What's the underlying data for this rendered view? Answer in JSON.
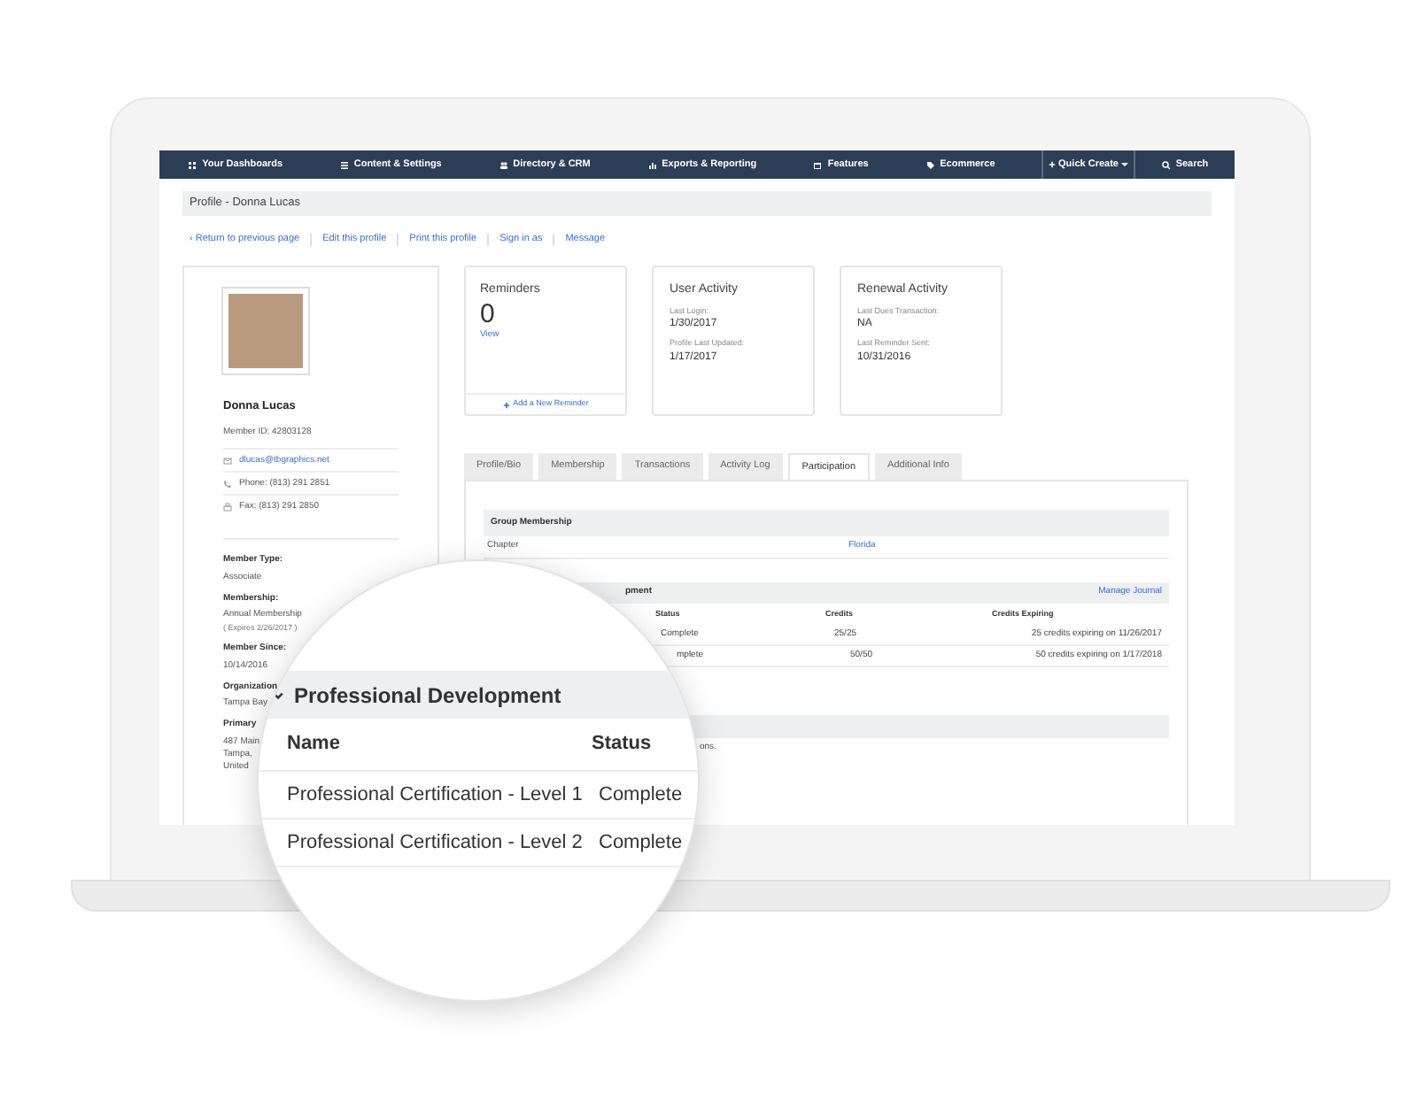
{
  "nav": {
    "items": [
      {
        "label": "Your Dashboards"
      },
      {
        "label": "Content & Settings"
      },
      {
        "label": "Directory & CRM"
      },
      {
        "label": "Exports & Reporting"
      },
      {
        "label": "Features"
      },
      {
        "label": "Ecommerce"
      }
    ],
    "quick_create": "Quick Create",
    "search": "Search"
  },
  "page_title": "Profile - Donna Lucas",
  "actions": [
    "‹ Return to previous page",
    "Edit this profile",
    "Print this profile",
    "Sign in as",
    "Message"
  ],
  "profile": {
    "name": "Donna Lucas",
    "member_id": "Member ID: 42803128",
    "contacts": [
      {
        "kind": "email",
        "text": "dlucas@tbgraphics.net"
      },
      {
        "kind": "phone",
        "text": "Phone: (813) 291 2851"
      },
      {
        "kind": "fax",
        "text": "Fax: (813) 291 2850"
      }
    ],
    "fields": [
      {
        "label": "Member Type:",
        "lines": [
          "Associate"
        ]
      },
      {
        "label": "Membership:",
        "lines": [
          "Annual Membership",
          "( Expires 2/26/2017 )"
        ]
      },
      {
        "label": "Member Since:",
        "lines": [
          "10/14/2016"
        ]
      },
      {
        "label": "Organization",
        "lines": [
          "Tampa Bay"
        ]
      },
      {
        "label": "Primary",
        "lines": [
          "487 Main",
          "Tampa,",
          "United"
        ]
      }
    ]
  },
  "reminders": {
    "title": "Reminders",
    "count": "0",
    "link": "View",
    "footer": "Add a New Reminder"
  },
  "activity_cards": [
    {
      "title": "User Activity",
      "items": [
        {
          "label": "Last Login:",
          "value": "1/30/2017"
        },
        {
          "label": "Profile Last Updated:",
          "value": "1/17/2017"
        }
      ]
    },
    {
      "title": "Renewal Activity",
      "items": [
        {
          "label": "Last Dues Transaction:",
          "value": "NA"
        },
        {
          "label": "Last Reminder Sent:",
          "value": "10/31/2016"
        }
      ]
    }
  ],
  "tabs": [
    {
      "label": "Profile/Bio",
      "selected": false
    },
    {
      "label": "Membership",
      "selected": false
    },
    {
      "label": "Transactions",
      "selected": false
    },
    {
      "label": "Activity Log",
      "selected": false
    },
    {
      "label": "Participation",
      "selected": true
    },
    {
      "label": "Additional Info",
      "selected": false
    }
  ],
  "group_membership": {
    "title": "Group Membership",
    "rows": [
      {
        "label": "Chapter",
        "value": "Florida"
      }
    ]
  },
  "professional_development": {
    "title": "pment",
    "action": "Manage Journal",
    "columns": [
      "Status",
      "Credits",
      "Credits Expiring"
    ],
    "rows": [
      {
        "status": "Complete",
        "credits": "25/25",
        "expiring": "25 credits expiring on 11/26/2017"
      },
      {
        "status": "mplete",
        "credits": "50/50",
        "expiring": "50 credits expiring on 1/17/2018"
      }
    ]
  },
  "third_section": {
    "note": "ons."
  },
  "magnifier": {
    "title": "Professional Development",
    "columns": [
      "Name",
      "Status"
    ],
    "rows": [
      {
        "name": "Professional Certification - Level 1",
        "status": "Complete"
      },
      {
        "name": "Professional Certification - Level 2",
        "status": "Complete"
      }
    ]
  }
}
